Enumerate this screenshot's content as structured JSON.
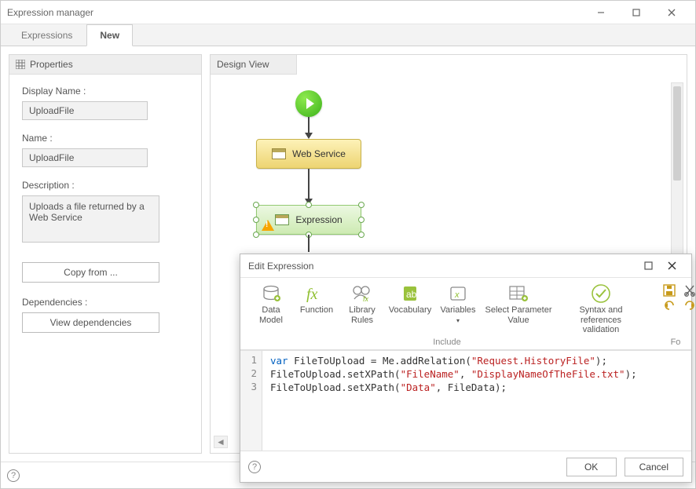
{
  "window": {
    "title": "Expression manager"
  },
  "tabs": [
    {
      "label": "Expressions",
      "active": false
    },
    {
      "label": "New",
      "active": true
    }
  ],
  "propertiesPanel": {
    "title": "Properties",
    "displayNameLabel": "Display Name :",
    "displayNameValue": "UploadFile",
    "nameLabel": "Name :",
    "nameValue": "UploadFile",
    "descriptionLabel": "Description :",
    "descriptionValue": "Uploads a file returned by a Web Service",
    "copyFromLabel": "Copy from ...",
    "dependenciesLabel": "Dependencies :",
    "viewDependenciesLabel": "View dependencies"
  },
  "designPanel": {
    "title": "Design View",
    "nodes": {
      "webService": "Web Service",
      "expression": "Expression"
    }
  },
  "editExpression": {
    "title": "Edit Expression",
    "ribbon": {
      "dataModel": "Data\nModel",
      "function": "Function",
      "libraryRules": "Library\nRules",
      "vocabulary": "Vocabulary",
      "variables": "Variables",
      "selectParameterValue": "Select Parameter\nValue",
      "syntaxValidation": "Syntax and references\nvalidation",
      "includeCaption": "Include",
      "formatCaption": "Fo"
    },
    "code": {
      "lines": [
        "1",
        "2",
        "3"
      ],
      "l1_kw": "var",
      "l1_a": " FileToUpload = Me.addRelation(",
      "l1_s": "\"Request.HistoryFile\"",
      "l1_b": ");",
      "l2_a": "FileToUpload.setXPath(",
      "l2_s1": "\"FileName\"",
      "l2_m": ", ",
      "l2_s2": "\"DisplayNameOfTheFile.txt\"",
      "l2_b": ");",
      "l3_a": "FileToUpload.setXPath(",
      "l3_s1": "\"Data\"",
      "l3_m": ", FileData);"
    },
    "buttons": {
      "ok": "OK",
      "cancel": "Cancel"
    }
  }
}
